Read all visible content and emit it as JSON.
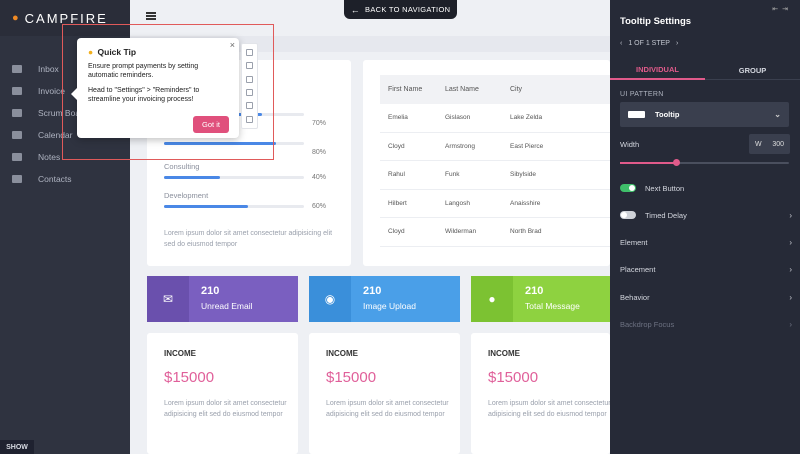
{
  "sidebar": {
    "brand": "CAMPFIRE",
    "items": [
      {
        "label": "Inbox",
        "icon": "mail-icon"
      },
      {
        "label": "Invoice",
        "icon": "invoice-icon"
      },
      {
        "label": "Scrum Board",
        "icon": "checkbox-icon"
      },
      {
        "label": "Calendar",
        "icon": "calendar-icon"
      },
      {
        "label": "Notes",
        "icon": "notes-icon"
      },
      {
        "label": "Contacts",
        "icon": "contacts-icon"
      }
    ],
    "show_label": "SHOW"
  },
  "header": {
    "back_label": "BACK TO NAVIGATION"
  },
  "progress": {
    "items": [
      {
        "label": "",
        "value": "70%",
        "percent": 70
      },
      {
        "label": "",
        "value": "80%",
        "percent": 80
      },
      {
        "label": "Consulting",
        "value": "40%",
        "percent": 40
      },
      {
        "label": "Development",
        "value": "60%",
        "percent": 60
      }
    ],
    "description": "Lorem ipsum dolor sit amet consectetur adipisicing elit sed do eiusmod tempor"
  },
  "table": {
    "headers": [
      "First Name",
      "Last Name",
      "City"
    ],
    "rows": [
      [
        "Emelia",
        "Gislason",
        "Lake Zelda"
      ],
      [
        "Cloyd",
        "Armstrong",
        "East Pierce"
      ],
      [
        "Rahul",
        "Funk",
        "Sibylside"
      ],
      [
        "Hilbert",
        "Langosh",
        "Anaisshire"
      ],
      [
        "Cloyd",
        "Wilderman",
        "North Brad"
      ]
    ]
  },
  "stats": {
    "email": {
      "number": "210",
      "label": "Unread Email"
    },
    "image": {
      "number": "210",
      "label": "Image Upload"
    },
    "message": {
      "number": "210",
      "label": "Total Message"
    }
  },
  "income": {
    "title": "INCOME",
    "amount": "$15000",
    "description": "Lorem ipsum dolor sit amet consectetur adipisicing elit sed do eiusmod tempor"
  },
  "tooltip": {
    "title": "Quick Tip",
    "body1": "Ensure prompt payments by setting automatic reminders.",
    "body2": "Head to \"Settings\" > \"Reminders\" to streamline your invoicing process!",
    "button": "Got it",
    "close": "×"
  },
  "settings": {
    "title": "Tooltip Settings",
    "step": "1 OF 1 STEP",
    "tabs": [
      "INDIVIDUAL",
      "GROUP"
    ],
    "ui_pattern_label": "UI PATTERN",
    "ui_pattern_value": "Tooltip",
    "width_label": "Width",
    "width_unit": "W",
    "width_value": "300",
    "width_fraction": 0.33,
    "next_button": "Next Button",
    "timed_delay": "Timed Delay",
    "element": "Element",
    "placement": "Placement",
    "behavior": "Behavior",
    "backdrop_focus": "Backdrop Focus"
  }
}
